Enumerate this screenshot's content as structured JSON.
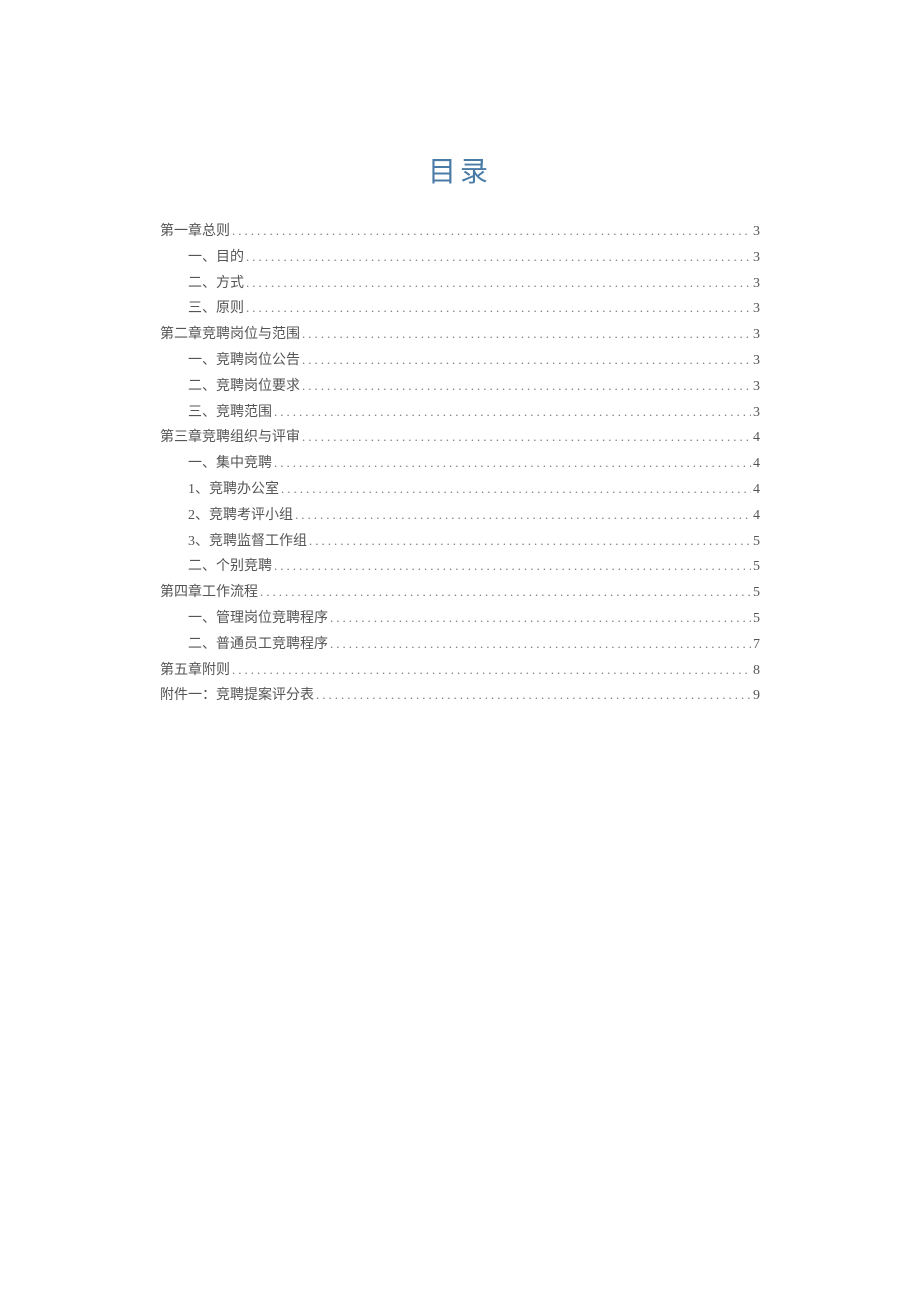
{
  "title": "目录",
  "toc": [
    {
      "level": 0,
      "label": "第一章总则",
      "page": "3"
    },
    {
      "level": 1,
      "label": "一、目的",
      "page": "3"
    },
    {
      "level": 1,
      "label": "二、方式",
      "page": "3"
    },
    {
      "level": 1,
      "label": "三、原则",
      "page": "3"
    },
    {
      "level": 0,
      "label": "第二章竞聘岗位与范围",
      "page": "3"
    },
    {
      "level": 1,
      "label": "一、竞聘岗位公告",
      "page": "3"
    },
    {
      "level": 1,
      "label": "二、竞聘岗位要求",
      "page": "3"
    },
    {
      "level": 1,
      "label": "三、竞聘范围",
      "page": "3"
    },
    {
      "level": 0,
      "label": "第三章竞聘组织与评审",
      "page": "4"
    },
    {
      "level": 1,
      "label": "一、集中竞聘",
      "page": "4"
    },
    {
      "level": 2,
      "label": "1、竞聘办公室",
      "page": "4"
    },
    {
      "level": 2,
      "label": "2、竞聘考评小组",
      "page": "4"
    },
    {
      "level": 2,
      "label": "3、竞聘监督工作组",
      "page": "5"
    },
    {
      "level": 1,
      "label": "二、个别竞聘",
      "page": "5"
    },
    {
      "level": 0,
      "label": "第四章工作流程",
      "page": "5"
    },
    {
      "level": 1,
      "label": "一、管理岗位竞聘程序",
      "page": "5"
    },
    {
      "level": 1,
      "label": "二、普通员工竞聘程序",
      "page": "7"
    },
    {
      "level": 0,
      "label": "第五章附则",
      "page": "8"
    },
    {
      "level": 0,
      "label": "附件一：竞聘提案评分表",
      "page": "9"
    }
  ]
}
